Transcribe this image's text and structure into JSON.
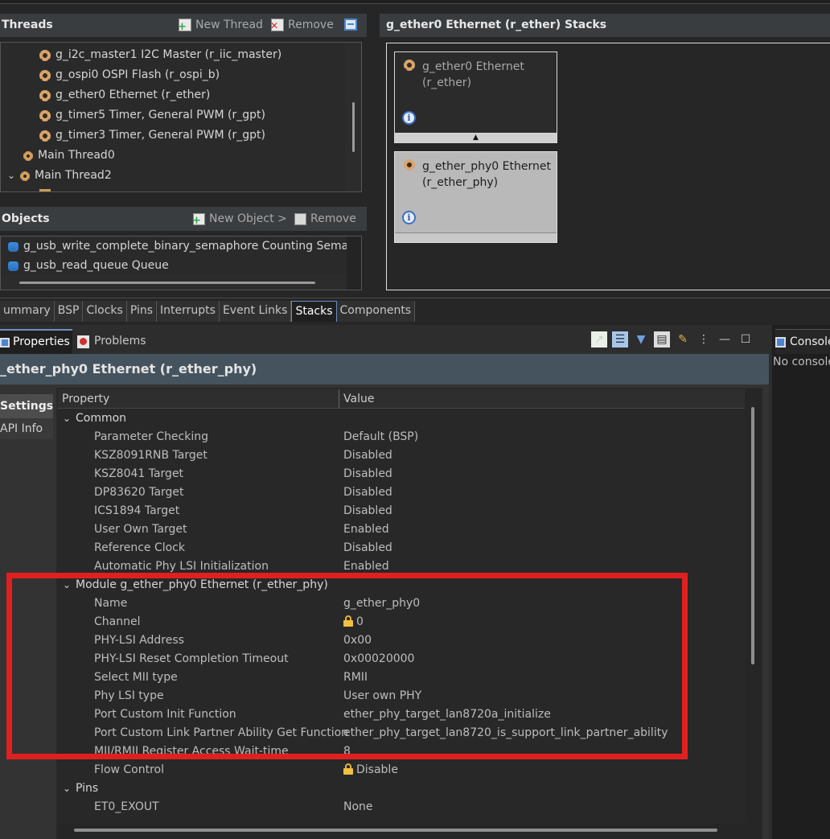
{
  "threads_panel": {
    "title": "Threads",
    "new_thread": "New Thread",
    "remove": "Remove",
    "items": [
      {
        "label": "g_i2c_master1 I2C Master (r_iic_master)"
      },
      {
        "label": "g_ospi0 OSPI Flash (r_ospi_b)"
      },
      {
        "label": "g_ether0 Ethernet (r_ether)"
      },
      {
        "label": "g_timer5 Timer, General PWM (r_gpt)"
      },
      {
        "label": "g_timer3 Timer, General PWM (r_gpt)"
      },
      {
        "label": "Main Thread0"
      },
      {
        "label": "Main Thread2"
      }
    ]
  },
  "objects_panel": {
    "title": "Objects",
    "new_object": "New Object >",
    "remove": "Remove",
    "items": [
      {
        "label": "g_usb_write_complete_binary_semaphore Counting Semaphore"
      },
      {
        "label": "g_usb_read_queue Queue"
      }
    ]
  },
  "stacks_panel": {
    "title": "g_ether0 Ethernet (r_ether) Stacks",
    "box1": {
      "line1": "g_ether0 Ethernet",
      "line2": "(r_ether)"
    },
    "box2": {
      "line1": "g_ether_phy0 Ethernet",
      "line2": "(r_ether_phy)"
    }
  },
  "editor_tabs": [
    "ummary",
    "BSP",
    "Clocks",
    "Pins",
    "Interrupts",
    "Event Links",
    "Stacks",
    "Components"
  ],
  "active_editor_tab": "Stacks",
  "properties_view": {
    "tab_properties": "Properties",
    "tab_problems": "Problems",
    "title": "_ether_phy0 Ethernet (r_ether_phy)",
    "side_tabs": [
      "Settings",
      "API Info"
    ],
    "col_property": "Property",
    "col_value": "Value",
    "sections": {
      "common": "Common",
      "module": "Module g_ether_phy0 Ethernet (r_ether_phy)",
      "pins": "Pins"
    },
    "rows": [
      {
        "name": "Parameter Checking",
        "value": "Default (BSP)"
      },
      {
        "name": "KSZ8091RNB Target",
        "value": "Disabled"
      },
      {
        "name": "KSZ8041 Target",
        "value": "Disabled"
      },
      {
        "name": "DP83620 Target",
        "value": "Disabled"
      },
      {
        "name": "ICS1894 Target",
        "value": "Disabled"
      },
      {
        "name": "User Own Target",
        "value": "Enabled"
      },
      {
        "name": "Reference Clock",
        "value": "Disabled"
      },
      {
        "name": "Automatic Phy LSI Initialization",
        "value": "Enabled"
      },
      {
        "name": "Name",
        "value": "g_ether_phy0"
      },
      {
        "name": "Channel",
        "value": "0"
      },
      {
        "name": "PHY-LSI Address",
        "value": "0x00"
      },
      {
        "name": "PHY-LSI Reset Completion Timeout",
        "value": "0x00020000"
      },
      {
        "name": "Select MII type",
        "value": "RMII"
      },
      {
        "name": "Phy LSI type",
        "value": "User own PHY"
      },
      {
        "name": "Port Custom Init Function",
        "value": "ether_phy_target_lan8720a_initialize"
      },
      {
        "name": "Port Custom Link Partner Ability Get Function",
        "value": "ether_phy_target_lan8720_is_support_link_partner_ability"
      },
      {
        "name": "MII/RMII Register Access Wait-time",
        "value": "8"
      },
      {
        "name": "Flow Control",
        "value": "Disable"
      },
      {
        "name": "ET0_EXOUT",
        "value": "None"
      }
    ]
  },
  "console_view": {
    "tab": "Console",
    "text": "No console"
  },
  "colors": {
    "highlight": "#e02020",
    "accent_blue": "#6a8fbf"
  }
}
